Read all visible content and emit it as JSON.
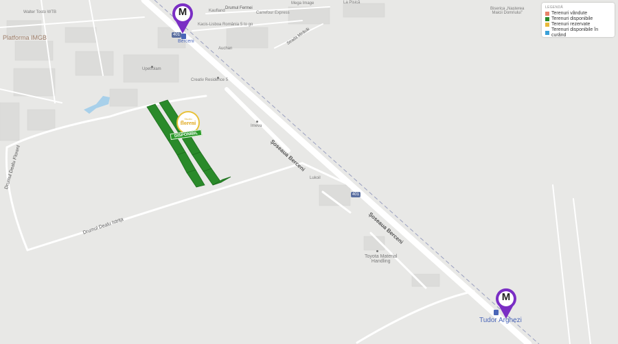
{
  "legend": {
    "title": "LEGENDĂ",
    "items": [
      {
        "label": "Terenuri vândute",
        "color": "#e8826a"
      },
      {
        "label": "Terenuri disponibile",
        "color": "#2a8a2a"
      },
      {
        "label": "Terenuri rezervate",
        "color": "#e8b83a"
      },
      {
        "label": "Terenuri disponibile în curând",
        "color": "#3aa0d8"
      }
    ]
  },
  "metro": {
    "top_station": "Berceni",
    "bottom_station": "Tudor Arghezi",
    "pin_letter": "M",
    "pin_color": "#7a2ec4"
  },
  "project": {
    "brand_small": "Studio",
    "brand": "floreni",
    "badge": "DISPONIBIL",
    "plot_color": "#2a8a2a"
  },
  "roads": {
    "main_1": "Șoseaua Berceni",
    "main_2": "Șoseaua Berceni",
    "istrita": "Drumul Dealu Istrița",
    "floreni": "Drumul Dealu Florenl",
    "farmei": "Drumul Fermei",
    "mirkului": "Strada Mirăcăi",
    "route_top": "401",
    "route_mid": "401"
  },
  "places": {
    "platforma": "Platforma IMGB",
    "walter": "Walter Tosto WTB",
    "upetrolam": "Upetrolam",
    "creativ": "Creativ Residence 5",
    "imeva": "Imeva",
    "lukoil": "Lukoil",
    "toyota": "Toyota Material\nHandling",
    "auchan": "Auchan",
    "kaufland": "Kaufland",
    "carrefour": "Carrefour Express",
    "kacis": "Kacis-Lisboa România",
    "fitgo": "5 to go",
    "mega": "Mega Image",
    "lapaica": "La Pisică",
    "biserica": "Biserica „Nașterea\nMaicii Domnului”"
  }
}
